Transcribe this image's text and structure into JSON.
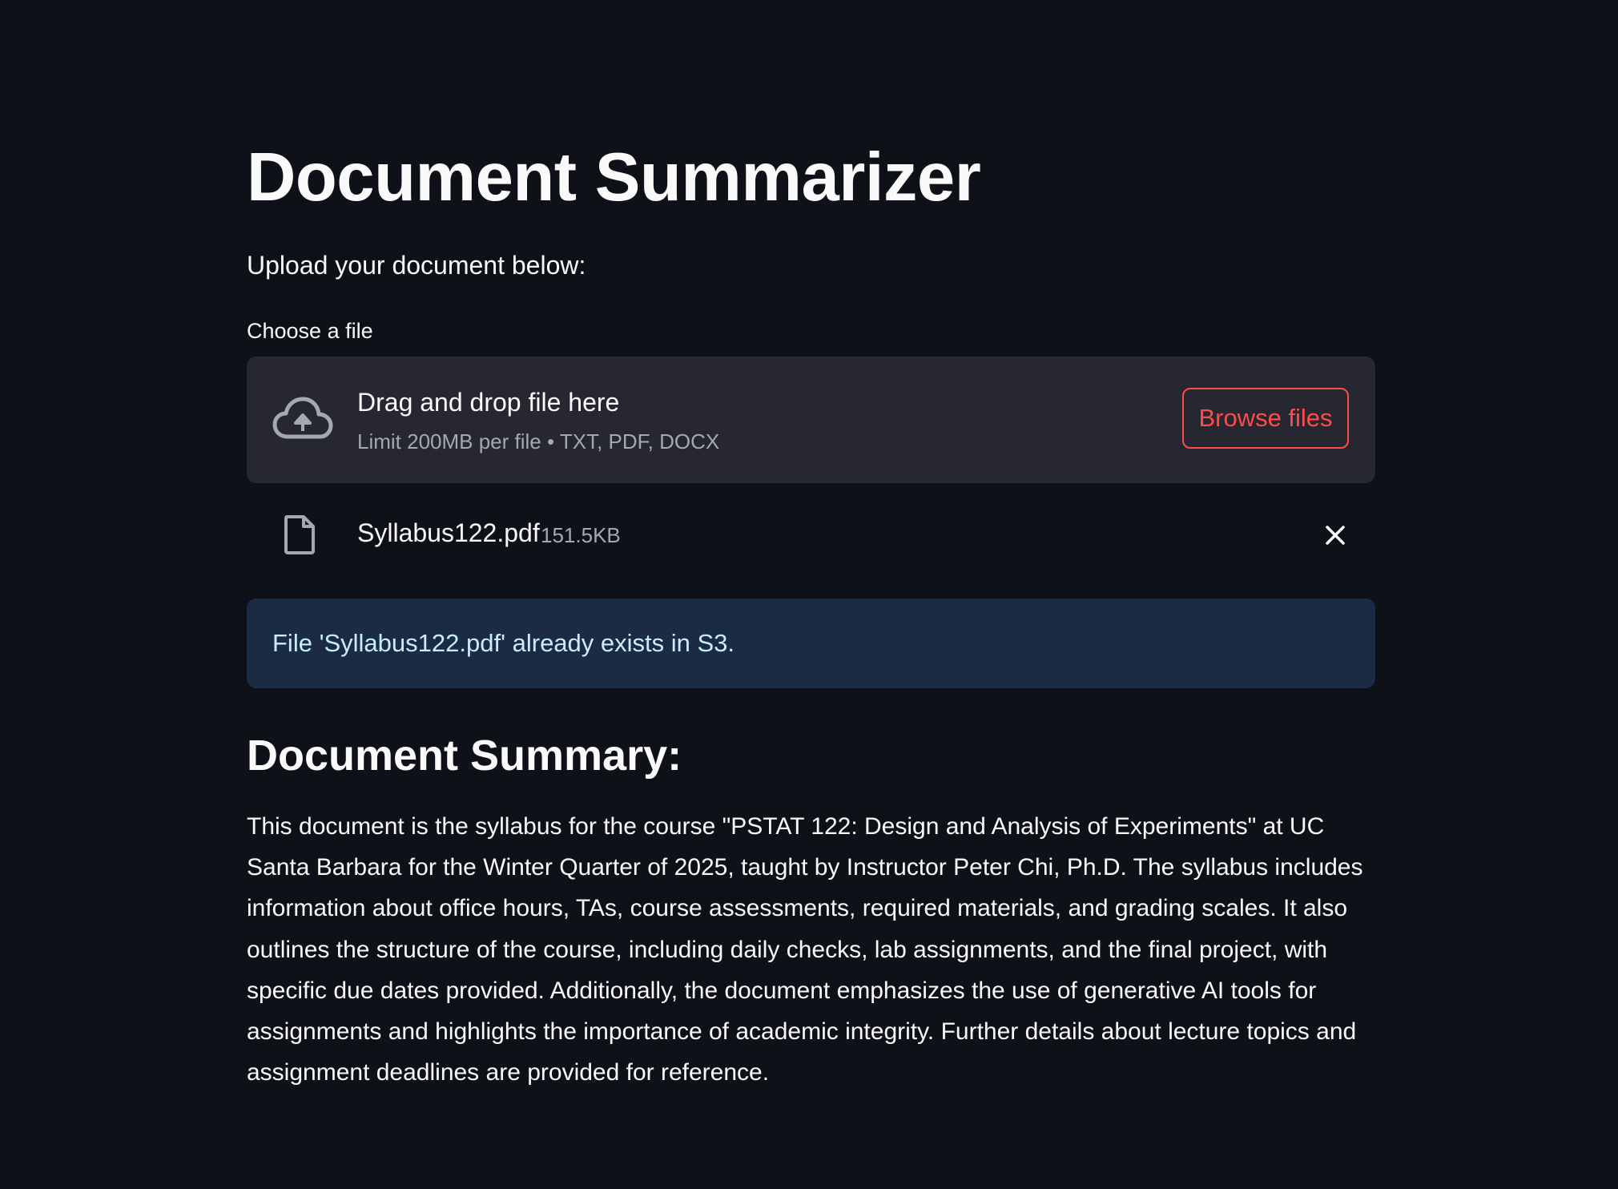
{
  "page": {
    "title": "Document Summarizer",
    "intro": "Upload your document below:"
  },
  "uploader": {
    "label": "Choose a file",
    "dropzone_title": "Drag and drop file here",
    "dropzone_limit": "Limit 200MB per file • TXT, PDF, DOCX",
    "browse_label": "Browse files",
    "upload_icon": "cloud-upload-icon"
  },
  "uploaded_file": {
    "name": "Syllabus122.pdf",
    "size": "151.5KB",
    "file_icon": "document-icon",
    "remove_icon": "close-icon"
  },
  "info": {
    "message": "File 'Syllabus122.pdf' already exists in S3."
  },
  "summary": {
    "heading": "Document Summary:",
    "text": "This document is the syllabus for the course \"PSTAT 122: Design and Analysis of Experiments\" at UC Santa Barbara for the Winter Quarter of 2025, taught by Instructor Peter Chi, Ph.D. The syllabus includes information about office hours, TAs, course assessments, required materials, and grading scales. It also outlines the structure of the course, including daily checks, lab assignments, and the final project, with specific due dates provided. Additionally, the document emphasizes the use of generative AI tools for assignments and highlights the importance of academic integrity. Further details about lecture topics and assignment deadlines are provided for reference."
  },
  "colors": {
    "background": "#0e1117",
    "dropzone_bg": "#262730",
    "accent": "#ff4b4b",
    "info_bg": "#1c2b44",
    "info_text": "#c7ebff",
    "muted_text": "#a3a8b4"
  }
}
